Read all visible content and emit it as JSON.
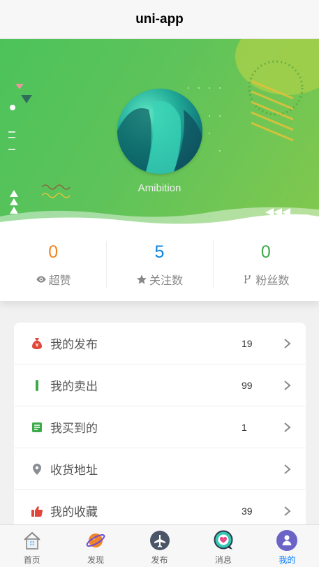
{
  "header": {
    "title": "uni-app"
  },
  "profile": {
    "username": "Amibition"
  },
  "stats": [
    {
      "value": "0",
      "label": "超赞",
      "icon": "eye-icon",
      "color": "#f0851e"
    },
    {
      "value": "5",
      "label": "关注数",
      "icon": "star-icon",
      "color": "#0a83e0"
    },
    {
      "value": "0",
      "label": "粉丝数",
      "icon": "branch-icon",
      "color": "#3bab4a"
    }
  ],
  "menu": [
    {
      "label": "我的发布",
      "count": "19",
      "icon": "money-bag-icon"
    },
    {
      "label": "我的卖出",
      "count": "99",
      "icon": "bar-icon"
    },
    {
      "label": "我买到的",
      "count": "1",
      "icon": "note-icon"
    },
    {
      "label": "收货地址",
      "count": "",
      "icon": "location-pin-icon"
    },
    {
      "label": "我的收藏",
      "count": "39",
      "icon": "thumbs-up-icon"
    }
  ],
  "tabs": [
    {
      "label": "首页",
      "icon": "home-icon"
    },
    {
      "label": "发现",
      "icon": "planet-icon"
    },
    {
      "label": "发布",
      "icon": "plane-icon"
    },
    {
      "label": "消息",
      "icon": "chat-heart-icon"
    },
    {
      "label": "我的",
      "icon": "user-icon",
      "active": true
    }
  ]
}
